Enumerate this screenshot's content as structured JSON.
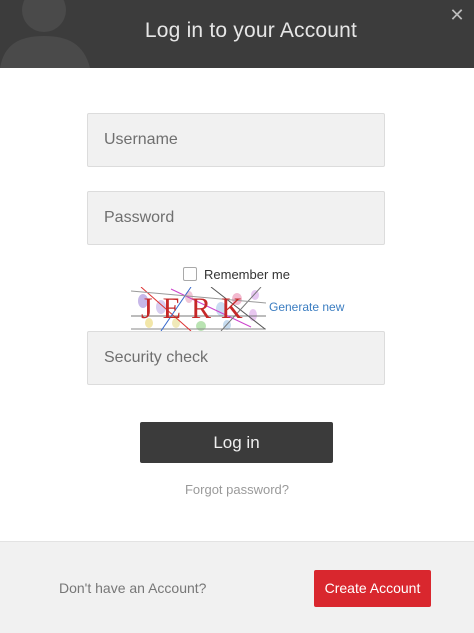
{
  "header": {
    "title": "Log in to your Account",
    "close_icon": "close-icon",
    "avatar_icon": "user-silhouette-icon"
  },
  "form": {
    "username_placeholder": "Username",
    "username_value": "",
    "password_placeholder": "Password",
    "password_value": "",
    "remember_label": "Remember me",
    "remember_checked": false,
    "captcha_text": "JERK",
    "generate_label": "Generate new",
    "security_placeholder": "Security check",
    "security_value": "",
    "login_label": "Log in",
    "forgot_label": "Forgot password?"
  },
  "footer": {
    "prompt": "Don't have an Account?",
    "create_label": "Create Account"
  },
  "colors": {
    "header_bg": "#3c3c3c",
    "primary_button": "#3b3b3b",
    "create_button": "#d9272e",
    "link": "#3b7dc1"
  }
}
